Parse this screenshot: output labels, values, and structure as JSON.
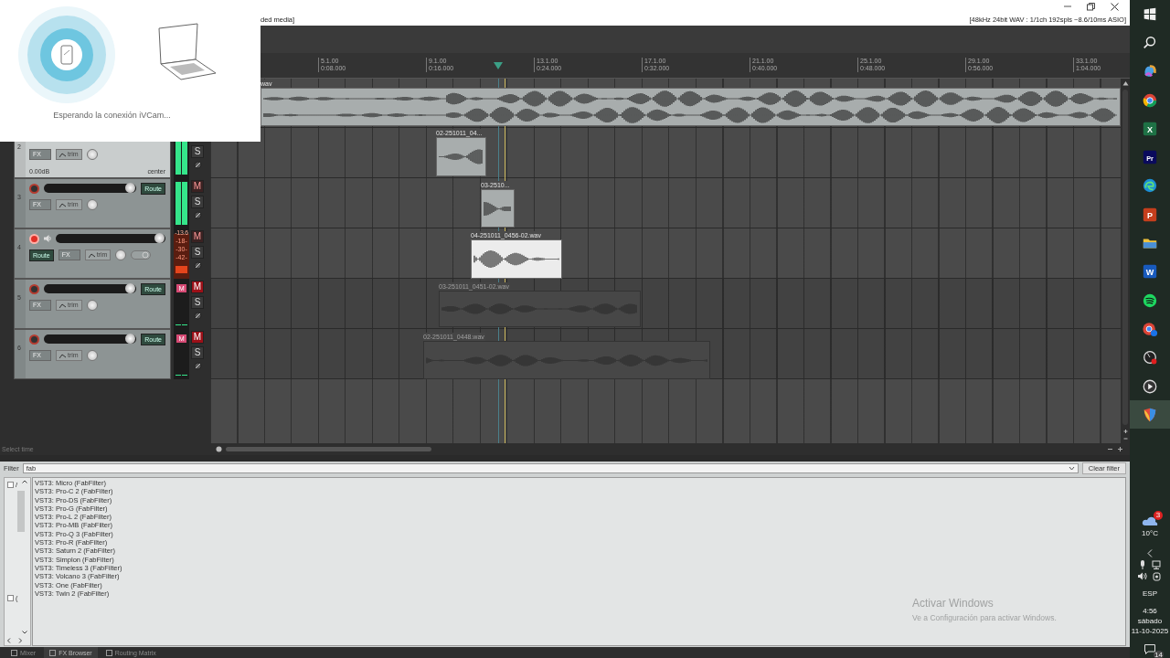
{
  "title_bar": {
    "title": "ded media]",
    "status": "[48kHz 24bit WAV : 1/1ch 192spls ~8.6/10ms ASIO]"
  },
  "popup": {
    "message": "Esperando la conexión iVCam..."
  },
  "ruler": {
    "marks": [
      {
        "bar": "5.1.00",
        "time": "0:08.000"
      },
      {
        "bar": "9.1.00",
        "time": "0:16.000"
      },
      {
        "bar": "13.1.00",
        "time": "0:24.000"
      },
      {
        "bar": "17.1.00",
        "time": "0:32.000"
      },
      {
        "bar": "21.1.00",
        "time": "0:40.000"
      },
      {
        "bar": "25.1.00",
        "time": "0:48.000"
      },
      {
        "bar": "29.1.00",
        "time": "0:56.000"
      },
      {
        "bar": "33.1.00",
        "time": "1:04.000"
      }
    ]
  },
  "master_lane": {
    "clip_label": "wav"
  },
  "tracks": [
    {
      "number": "2",
      "kind": "covered",
      "selected": true,
      "armed": false,
      "monitor": false,
      "muted": false,
      "fx_label": "FX",
      "trim_label": "trim",
      "volume": "0.00dB",
      "pan": "center",
      "solo_label": "S",
      "meter": {
        "level": 1,
        "clipped": false
      },
      "clip": {
        "label": "02-251011_04...",
        "selected": false
      }
    },
    {
      "number": "3",
      "kind": "full",
      "selected": false,
      "armed": false,
      "monitor": false,
      "muted": false,
      "route_label": "Route",
      "fx_label": "FX",
      "trim_label": "trim",
      "mute_label": "M",
      "solo_label": "S",
      "meter": {
        "level": 1,
        "clipped": false
      },
      "clip": {
        "label": "03-2510...",
        "selected": false
      }
    },
    {
      "number": "4",
      "kind": "monitored",
      "selected": false,
      "armed": true,
      "monitor": true,
      "muted": false,
      "route_label": "Route",
      "fx_label": "FX",
      "trim_label": "trim",
      "mute_label": "M",
      "solo_label": "S",
      "meter": {
        "level": 0.15,
        "clipped": true,
        "peak": "-13.6",
        "scale": [
          "-18-",
          "-30-",
          "-42-"
        ]
      },
      "clip": {
        "label": "04-251011_0456-02.wav",
        "selected": true
      }
    },
    {
      "number": "5",
      "kind": "full",
      "selected": false,
      "armed": false,
      "monitor": false,
      "muted": true,
      "route_label": "Route",
      "fx_label": "FX",
      "trim_label": "trim",
      "mute_label": "M",
      "solo_label": "S",
      "meter": {
        "level": 0,
        "clipped": false,
        "badge": "M"
      },
      "clip": {
        "label": "03-251011_0451-02.wav",
        "selected": false
      }
    },
    {
      "number": "6",
      "kind": "full",
      "selected": false,
      "armed": false,
      "monitor": false,
      "muted": true,
      "route_label": "Route",
      "fx_label": "FX",
      "trim_label": "trim",
      "mute_label": "M",
      "solo_label": "S",
      "meter": {
        "level": 0,
        "clipped": false,
        "badge": "M"
      },
      "clip": {
        "label": "02-251011_0448.wav",
        "selected": false
      }
    }
  ],
  "status_text": "Select time",
  "fx_browser": {
    "filter_label": "Filter",
    "filter_value": "fab",
    "clear_label": "Clear filter",
    "tree_items": [
      {
        "label": "/",
        "checked": false
      },
      {
        "label": "(",
        "checked": false
      }
    ],
    "items": [
      "VST3: Micro (FabFilter)",
      "VST3: Pro-C 2 (FabFilter)",
      "VST3: Pro-DS (FabFilter)",
      "VST3: Pro-G (FabFilter)",
      "VST3: Pro-L 2 (FabFilter)",
      "VST3: Pro-MB (FabFilter)",
      "VST3: Pro-Q 3 (FabFilter)",
      "VST3: Pro-R (FabFilter)",
      "VST3: Saturn 2 (FabFilter)",
      "VST3: Simplon (FabFilter)",
      "VST3: Timeless 3 (FabFilter)",
      "VST3: Volcano 3 (FabFilter)",
      "VST3: One (FabFilter)",
      "VST3: Twin 2 (FabFilter)"
    ]
  },
  "activation": {
    "title": "Activar Windows",
    "subtitle": "Ve a Configuración para activar Windows."
  },
  "dock_tabs": [
    {
      "label": "Mixer",
      "selected": false
    },
    {
      "label": "FX Browser",
      "selected": true
    },
    {
      "label": "Routing Matrix",
      "selected": false
    }
  ],
  "taskbar": {
    "apps": [
      {
        "kind": "start",
        "selected": false
      },
      {
        "kind": "search",
        "selected": false
      },
      {
        "kind": "blob",
        "selected": false
      },
      {
        "kind": "ring",
        "selected": false
      },
      {
        "kind": "tile",
        "letters": "X",
        "color": "#1e7145",
        "selected": false
      },
      {
        "kind": "tile",
        "letters": "Pr",
        "color": "#0a0a5c",
        "selected": false
      },
      {
        "kind": "swirl",
        "selected": false
      },
      {
        "kind": "tile",
        "letters": "P",
        "color": "#c43e1c",
        "selected": false
      },
      {
        "kind": "folder",
        "selected": false
      },
      {
        "kind": "tile",
        "letters": "W",
        "color": "#185abd",
        "selected": false
      },
      {
        "kind": "waves",
        "selected": false
      },
      {
        "kind": "ringbadge",
        "selected": false
      },
      {
        "kind": "gauge",
        "selected": false
      },
      {
        "kind": "play",
        "selected": false
      },
      {
        "kind": "shield",
        "selected": true
      }
    ],
    "weather": {
      "temp": "10°C",
      "badge": "3"
    },
    "language": "ESP",
    "clock": {
      "time": "4:56",
      "day": "sábado",
      "date": "11-10-2025"
    },
    "notifications": "14"
  }
}
